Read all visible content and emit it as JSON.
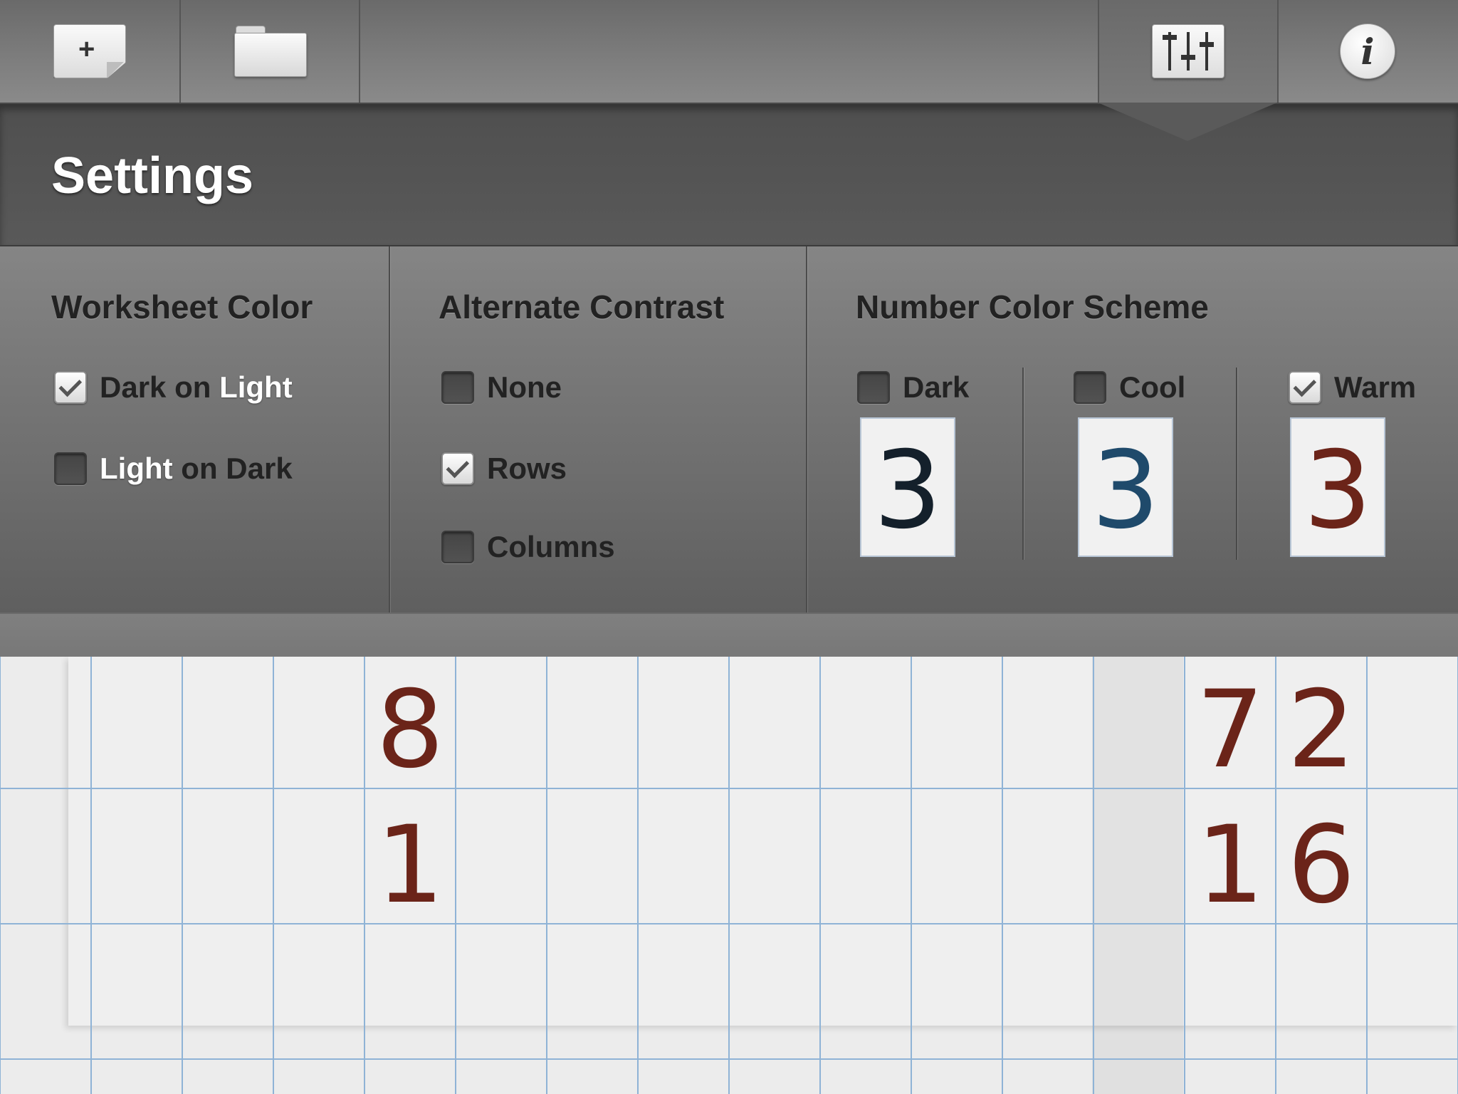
{
  "header": {
    "title": "Settings",
    "active_tab": "settings"
  },
  "toolbar": {
    "icons": [
      "new-document-icon",
      "folder-icon",
      "sliders-icon",
      "info-icon"
    ],
    "info_glyph": "i",
    "new_doc_glyph": "+"
  },
  "worksheet_color": {
    "title": "Worksheet Color",
    "options": [
      {
        "label_a": "Dark",
        "label_mid": " on ",
        "label_b": "Light",
        "checked": true
      },
      {
        "label_a": "Light",
        "label_mid": " on ",
        "label_b": "Dark",
        "checked": false
      }
    ]
  },
  "alternate_contrast": {
    "title": "Alternate Contrast",
    "options": [
      {
        "label": "None",
        "checked": false
      },
      {
        "label": "Rows",
        "checked": true
      },
      {
        "label": "Columns",
        "checked": false
      }
    ]
  },
  "number_color_scheme": {
    "title": "Number Color Scheme",
    "schemes": [
      {
        "label": "Dark",
        "checked": false,
        "sample": "3",
        "color": "#14202b"
      },
      {
        "label": "Cool",
        "checked": false,
        "sample": "3",
        "color": "#1f4a6b"
      },
      {
        "label": "Warm",
        "checked": true,
        "sample": "3",
        "color": "#6b2419"
      }
    ]
  },
  "worksheet": {
    "digit_color": "#6b2419",
    "grid_color": "#8fb3d6",
    "cells": [
      {
        "row": 0,
        "col": 4,
        "value": "8"
      },
      {
        "row": 0,
        "col": 13,
        "value": "7"
      },
      {
        "row": 0,
        "col": 14,
        "value": "2"
      },
      {
        "row": 1,
        "col": 4,
        "value": "1"
      },
      {
        "row": 1,
        "col": 13,
        "value": "1"
      },
      {
        "row": 1,
        "col": 14,
        "value": "6"
      }
    ]
  }
}
